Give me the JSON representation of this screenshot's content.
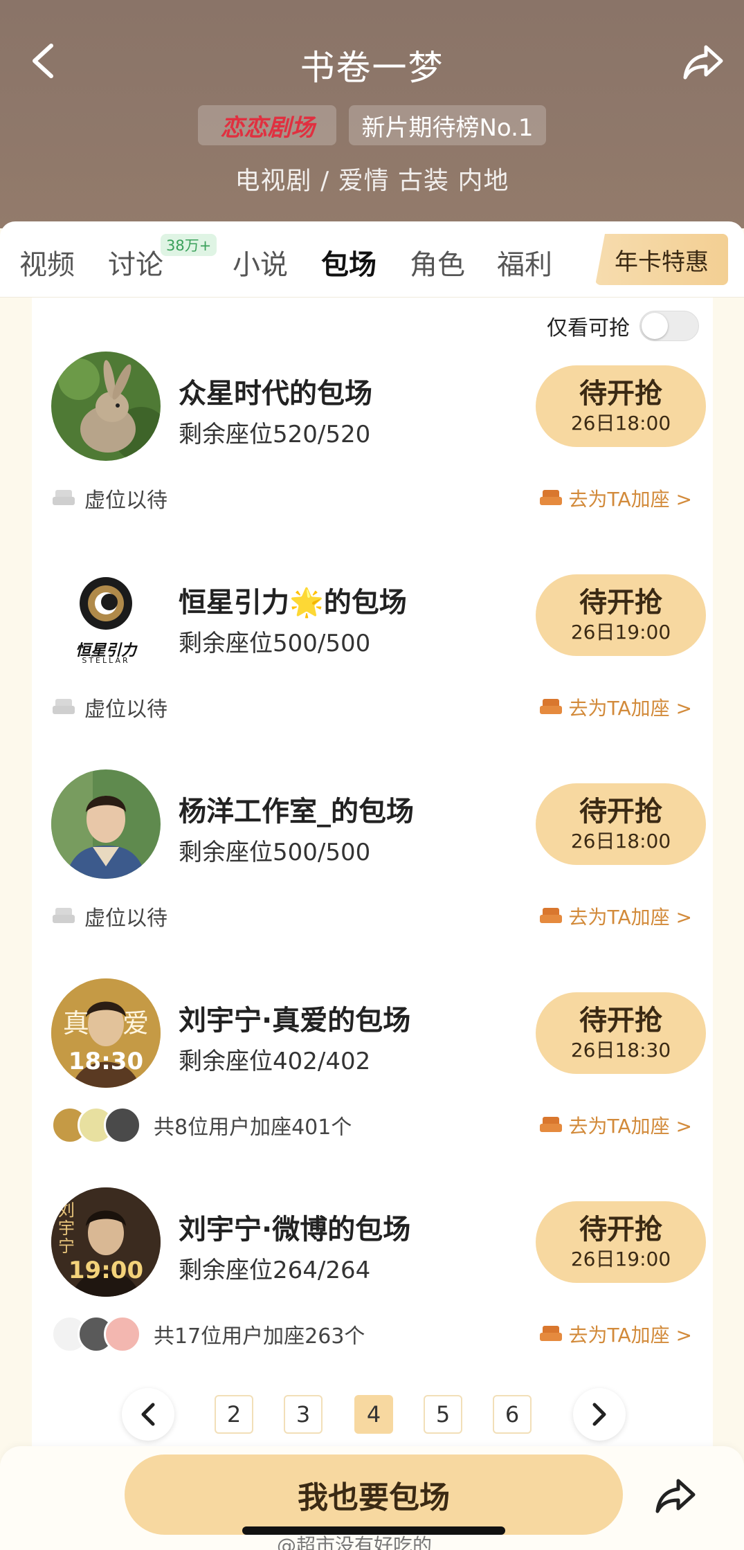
{
  "header": {
    "title": "书卷一梦",
    "logo_text": "恋恋剧场",
    "rank_badge": "新片期待榜No.1",
    "genres": "电视剧 / 爱情 古装 内地"
  },
  "tabs": [
    {
      "label": "视频"
    },
    {
      "label": "讨论",
      "count": "38万+"
    },
    {
      "label": "小说"
    },
    {
      "label": "包场"
    },
    {
      "label": "角色"
    },
    {
      "label": "福利"
    }
  ],
  "vip_tab": "年卡特惠",
  "filter": {
    "label": "仅看可抢",
    "enabled": false
  },
  "cards": [
    {
      "title": "众星时代的包场",
      "seats": "剩余座位520/520",
      "status": "待开抢",
      "time": "26日18:00",
      "footer_left": "虚位以待",
      "footer_right": "去为TA加座 >"
    },
    {
      "title": "恒星引力🌟的包场",
      "seats": "剩余座位500/500",
      "status": "待开抢",
      "time": "26日19:00",
      "footer_left": "虚位以待",
      "footer_right": "去为TA加座 >",
      "logo_sub": "恒星引力",
      "logo_en": "STELLAR"
    },
    {
      "title": "杨洋工作室_的包场",
      "seats": "剩余座位500/500",
      "status": "待开抢",
      "time": "26日18:00",
      "footer_left": "虚位以待",
      "footer_right": "去为TA加座 >"
    },
    {
      "title": "刘宇宁·真爱的包场",
      "seats": "剩余座位402/402",
      "status": "待开抢",
      "time": "26日18:30",
      "footer_left": "共8位用户加座401个",
      "footer_right": "去为TA加座 >",
      "avatar_text": "18:30",
      "avatar_big": "真    爱"
    },
    {
      "title": "刘宇宁·微博的包场",
      "seats": "剩余座位264/264",
      "status": "待开抢",
      "time": "26日19:00",
      "footer_left": "共17位用户加座263个",
      "footer_right": "去为TA加座 >",
      "avatar_text": "19:00",
      "avatar_big": "刘宇宁"
    }
  ],
  "pagination": {
    "pages": [
      "2",
      "3",
      "4",
      "5",
      "6"
    ],
    "current": "4"
  },
  "cta": "我也要包场",
  "watermark": "@超市没有好吃的",
  "colors": {
    "accent": "#f7d8a0",
    "header": "#8f786a",
    "link": "#d28a3a"
  }
}
